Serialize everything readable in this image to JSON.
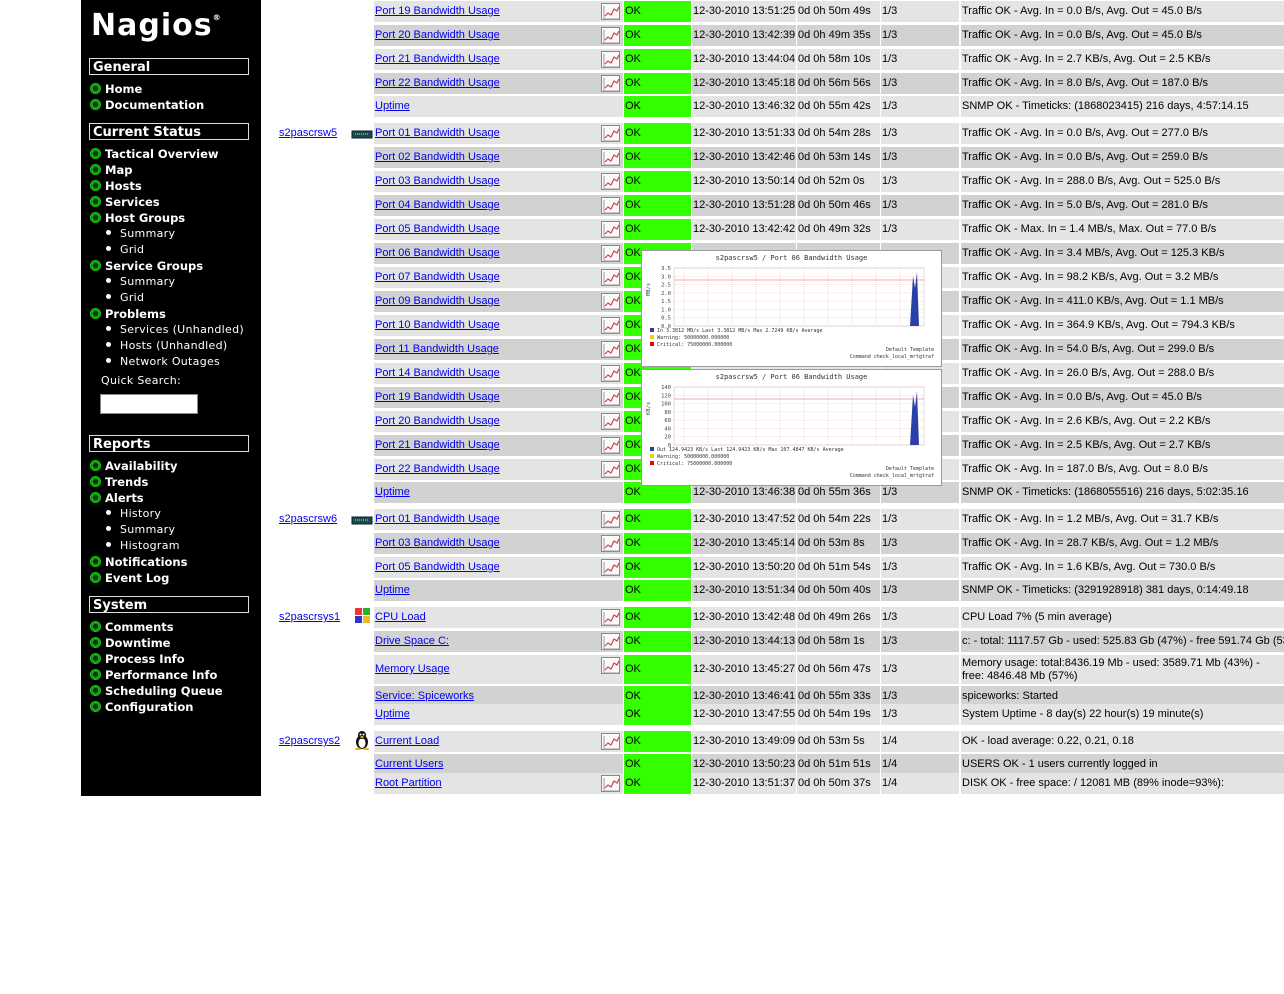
{
  "sidebar": {
    "logo": "Nagios",
    "logo_mark": "®",
    "sections": [
      {
        "title": "General",
        "items": [
          {
            "label": "Home",
            "sub": []
          },
          {
            "label": "Documentation",
            "sub": []
          }
        ]
      },
      {
        "title": "Current Status",
        "items": [
          {
            "label": "Tactical Overview",
            "sub": []
          },
          {
            "label": "Map",
            "sub": []
          },
          {
            "label": "Hosts",
            "sub": []
          },
          {
            "label": "Services",
            "sub": []
          },
          {
            "label": "Host Groups",
            "sub": [
              "Summary",
              "Grid"
            ]
          },
          {
            "label": "Service Groups",
            "sub": [
              "Summary",
              "Grid"
            ]
          },
          {
            "label": "Problems",
            "sub": [
              "Services (Unhandled)",
              "Hosts (Unhandled)",
              "Network Outages"
            ]
          }
        ]
      },
      {
        "title": "Reports",
        "items": [
          {
            "label": "Availability",
            "sub": []
          },
          {
            "label": "Trends",
            "sub": []
          },
          {
            "label": "Alerts",
            "sub": [
              "History",
              "Summary",
              "Histogram"
            ]
          },
          {
            "label": "Notifications",
            "sub": []
          },
          {
            "label": "Event Log",
            "sub": []
          }
        ]
      },
      {
        "title": "System",
        "items": [
          {
            "label": "Comments",
            "sub": []
          },
          {
            "label": "Downtime",
            "sub": []
          },
          {
            "label": "Process Info",
            "sub": []
          },
          {
            "label": "Performance Info",
            "sub": []
          },
          {
            "label": "Scheduling Queue",
            "sub": []
          },
          {
            "label": "Configuration",
            "sub": []
          }
        ]
      }
    ],
    "quick_search_label": "Quick Search:",
    "quick_search_value": ""
  },
  "colors": {
    "ok": "#33ff00",
    "row_light": "#e4e4e4",
    "row_dark": "#d2d2d2",
    "link": "#0000ee",
    "sidebar_bg": "#000000"
  },
  "groups": [
    {
      "host": "",
      "icon": "",
      "rows": [
        {
          "service": "Port 19 Bandwidth Usage",
          "graph": true,
          "status": "OK",
          "last_check": "12-30-2010 13:51:25",
          "duration": "0d 0h 50m 49s",
          "attempt": "1/3",
          "info": "Traffic OK - Avg. In = 0.0 B/s, Avg. Out = 45.0 B/s"
        },
        {
          "service": "Port 20 Bandwidth Usage",
          "graph": true,
          "status": "OK",
          "last_check": "12-30-2010 13:42:39",
          "duration": "0d 0h 49m 35s",
          "attempt": "1/3",
          "info": "Traffic OK - Avg. In = 0.0 B/s, Avg. Out = 45.0 B/s"
        },
        {
          "service": "Port 21 Bandwidth Usage",
          "graph": true,
          "status": "OK",
          "last_check": "12-30-2010 13:44:04",
          "duration": "0d 0h 58m 10s",
          "attempt": "1/3",
          "info": "Traffic OK - Avg. In = 2.7 KB/s, Avg. Out = 2.5 KB/s"
        },
        {
          "service": "Port 22 Bandwidth Usage",
          "graph": true,
          "status": "OK",
          "last_check": "12-30-2010 13:45:18",
          "duration": "0d 0h 56m 56s",
          "attempt": "1/3",
          "info": "Traffic OK - Avg. In = 8.0 B/s, Avg. Out = 187.0 B/s"
        },
        {
          "service": "Uptime",
          "graph": false,
          "status": "OK",
          "last_check": "12-30-2010 13:46:32",
          "duration": "0d 0h 55m 42s",
          "attempt": "1/3",
          "info": "SNMP OK - Timeticks: (1868023415) 216 days, 4:57:14.15"
        }
      ]
    },
    {
      "host": "s2pascrsw5",
      "icon": "switch-icon",
      "rows": [
        {
          "service": "Port 01 Bandwidth Usage",
          "graph": true,
          "status": "OK",
          "last_check": "12-30-2010 13:51:33",
          "duration": "0d 0h 54m 28s",
          "attempt": "1/3",
          "info": "Traffic OK - Avg. In = 0.0 B/s, Avg. Out = 277.0 B/s"
        },
        {
          "service": "Port 02 Bandwidth Usage",
          "graph": true,
          "status": "OK",
          "last_check": "12-30-2010 13:42:46",
          "duration": "0d 0h 53m 14s",
          "attempt": "1/3",
          "info": "Traffic OK - Avg. In = 0.0 B/s, Avg. Out = 259.0 B/s"
        },
        {
          "service": "Port 03 Bandwidth Usage",
          "graph": true,
          "status": "OK",
          "last_check": "12-30-2010 13:50:14",
          "duration": "0d 0h 52m 0s",
          "attempt": "1/3",
          "info": "Traffic OK - Avg. In = 288.0 B/s, Avg. Out = 525.0 B/s"
        },
        {
          "service": "Port 04 Bandwidth Usage",
          "graph": true,
          "status": "OK",
          "last_check": "12-30-2010 13:51:28",
          "duration": "0d 0h 50m 46s",
          "attempt": "1/3",
          "info": "Traffic OK - Avg. In = 5.0 B/s, Avg. Out = 281.0 B/s"
        },
        {
          "service": "Port 05 Bandwidth Usage",
          "graph": true,
          "status": "OK",
          "last_check": "12-30-2010 13:42:42",
          "duration": "0d 0h 49m 32s",
          "attempt": "1/3",
          "info": "Traffic OK - Max. In = 1.4 MB/s, Max. Out = 77.0 B/s"
        },
        {
          "service": "Port 06 Bandwidth Usage",
          "graph": true,
          "status": "OK",
          "last_check": "",
          "duration": "",
          "attempt": "",
          "info": "Traffic OK - Avg. In = 3.4 MB/s, Avg. Out = 125.3 KB/s"
        },
        {
          "service": "Port 07 Bandwidth Usage",
          "graph": true,
          "status": "OK",
          "last_check": "",
          "duration": "",
          "attempt": "",
          "info": "Traffic OK - Avg. In = 98.2 KB/s, Avg. Out = 3.2 MB/s"
        },
        {
          "service": "Port 09 Bandwidth Usage",
          "graph": true,
          "status": "OK",
          "last_check": "",
          "duration": "",
          "attempt": "",
          "info": "Traffic OK - Avg. In = 411.0 KB/s, Avg. Out = 1.1 MB/s"
        },
        {
          "service": "Port 10 Bandwidth Usage",
          "graph": true,
          "status": "OK",
          "last_check": "",
          "duration": "",
          "attempt": "",
          "info": "Traffic OK - Avg. In = 364.9 KB/s, Avg. Out = 794.3 KB/s"
        },
        {
          "service": "Port 11 Bandwidth Usage",
          "graph": true,
          "status": "OK",
          "last_check": "",
          "duration": "",
          "attempt": "",
          "info": "Traffic OK - Avg. In = 54.0 B/s, Avg. Out = 299.0 B/s"
        },
        {
          "service": "Port 14 Bandwidth Usage",
          "graph": true,
          "status": "OK",
          "last_check": "",
          "duration": "",
          "attempt": "",
          "info": "Traffic OK - Avg. In = 26.0 B/s, Avg. Out = 288.0 B/s"
        },
        {
          "service": "Port 19 Bandwidth Usage",
          "graph": true,
          "status": "OK",
          "last_check": "",
          "duration": "",
          "attempt": "",
          "info": "Traffic OK - Avg. In = 0.0 B/s, Avg. Out = 45.0 B/s"
        },
        {
          "service": "Port 20 Bandwidth Usage",
          "graph": true,
          "status": "OK",
          "last_check": "",
          "duration": "",
          "attempt": "",
          "info": "Traffic OK - Avg. In = 2.6 KB/s, Avg. Out = 2.2 KB/s"
        },
        {
          "service": "Port 21 Bandwidth Usage",
          "graph": true,
          "status": "OK",
          "last_check": "",
          "duration": "",
          "attempt": "",
          "info": "Traffic OK - Avg. In = 2.5 KB/s, Avg. Out = 2.7 KB/s"
        },
        {
          "service": "Port 22 Bandwidth Usage",
          "graph": true,
          "status": "OK",
          "last_check": "",
          "duration": "",
          "attempt": "",
          "info": "Traffic OK - Avg. In = 187.0 B/s, Avg. Out = 8.0 B/s"
        },
        {
          "service": "Uptime",
          "graph": false,
          "status": "OK",
          "last_check": "12-30-2010 13:46:38",
          "duration": "0d 0h 55m 36s",
          "attempt": "1/3",
          "info": "SNMP OK - Timeticks: (1868055516) 216 days, 5:02:35.16"
        }
      ]
    },
    {
      "host": "s2pascrsw6",
      "icon": "switch-icon",
      "rows": [
        {
          "service": "Port 01 Bandwidth Usage",
          "graph": true,
          "status": "OK",
          "last_check": "12-30-2010 13:47:52",
          "duration": "0d 0h 54m 22s",
          "attempt": "1/3",
          "info": "Traffic OK - Avg. In = 1.2 MB/s, Avg. Out = 31.7 KB/s"
        },
        {
          "service": "Port 03 Bandwidth Usage",
          "graph": true,
          "status": "OK",
          "last_check": "12-30-2010 13:45:14",
          "duration": "0d 0h 53m 8s",
          "attempt": "1/3",
          "info": "Traffic OK - Avg. In = 28.7 KB/s, Avg. Out = 1.2 MB/s"
        },
        {
          "service": "Port 05 Bandwidth Usage",
          "graph": true,
          "status": "OK",
          "last_check": "12-30-2010 13:50:20",
          "duration": "0d 0h 51m 54s",
          "attempt": "1/3",
          "info": "Traffic OK - Avg. In = 1.6 KB/s, Avg. Out = 730.0 B/s"
        },
        {
          "service": "Uptime",
          "graph": false,
          "status": "OK",
          "last_check": "12-30-2010 13:51:34",
          "duration": "0d 0h 50m 40s",
          "attempt": "1/3",
          "info": "SNMP OK - Timeticks: (3291928918) 381 days, 0:14:49.18"
        }
      ]
    },
    {
      "host": "s2pascrsys1",
      "icon": "windows-icon",
      "rows": [
        {
          "service": "CPU Load",
          "graph": true,
          "status": "OK",
          "last_check": "12-30-2010 13:42:48",
          "duration": "0d 0h 49m 26s",
          "attempt": "1/3",
          "info": "CPU Load 7% (5 min average)"
        },
        {
          "service": "Drive Space C:",
          "graph": true,
          "status": "OK",
          "last_check": "12-30-2010 13:44:13",
          "duration": "0d 0h 58m 1s",
          "attempt": "1/3",
          "info": "c: - total: 1117.57 Gb - used: 525.83 Gb (47%) - free 591.74 Gb (53%)"
        },
        {
          "service": "Memory Usage",
          "graph": true,
          "status": "OK",
          "last_check": "12-30-2010 13:45:27",
          "duration": "0d 0h 56m 47s",
          "attempt": "1/3",
          "info": "Memory usage: total:8436.19 Mb - used: 3589.71 Mb (43%) - free: 4846.48 Mb (57%)",
          "tall": true
        },
        {
          "service": "Service: Spiceworks",
          "graph": false,
          "status": "OK",
          "last_check": "12-30-2010 13:46:41",
          "duration": "0d 0h 55m 33s",
          "attempt": "1/3",
          "info": "spiceworks: Started"
        },
        {
          "service": "Uptime",
          "graph": false,
          "status": "OK",
          "last_check": "12-30-2010 13:47:55",
          "duration": "0d 0h 54m 19s",
          "attempt": "1/3",
          "info": "System Uptime - 8 day(s) 22 hour(s) 19 minute(s)"
        }
      ]
    },
    {
      "host": "s2pascrsys2",
      "icon": "linux-icon",
      "rows": [
        {
          "service": "Current Load",
          "graph": true,
          "status": "OK",
          "last_check": "12-30-2010 13:49:09",
          "duration": "0d 0h 53m 5s",
          "attempt": "1/4",
          "info": "OK - load average: 0.22, 0.21, 0.18"
        },
        {
          "service": "Current Users",
          "graph": false,
          "status": "OK",
          "last_check": "12-30-2010 13:50:23",
          "duration": "0d 0h 51m 51s",
          "attempt": "1/4",
          "info": "USERS OK - 1 users currently logged in"
        },
        {
          "service": "Root Partition",
          "graph": true,
          "status": "OK",
          "last_check": "12-30-2010 13:51:37",
          "duration": "0d 0h 50m 37s",
          "attempt": "1/4",
          "info": "DISK OK - free space: / 12081 MB (89% inode=93%):"
        }
      ]
    }
  ],
  "popups": [
    {
      "title": "s2pascrsw5 / Port 06 Bandwidth Usage",
      "y_ticks": [
        "3.5",
        "3.0",
        "2.5",
        "2.0",
        "1.5",
        "1.0",
        "0.5",
        "0.0"
      ],
      "y_unit": "MB/s",
      "legend": [
        "In      3.3812  MB/s Last  3.3812  MB/s Max  2.7249  KB/s Average",
        "Warning: 50000000.000000",
        "Critical: 75000000.000000"
      ],
      "footer": [
        "Default Template",
        "Command check_local_mrtgtraf"
      ]
    },
    {
      "title": "s2pascrsw5 / Port 06 Bandwidth Usage",
      "y_ticks": [
        "140",
        "120",
        "100",
        "80",
        "60",
        "40",
        "20",
        "0"
      ],
      "y_unit": "KB/s",
      "legend": [
        "Out     124.9423  KB/s Last  124.9423  KB/s Max  107.4847  KB/s Average",
        "Warning: 50000000.000000",
        "Critical: 75000000.000000"
      ],
      "footer": [
        "Default Template",
        "Command check_local_mrtgtraf"
      ]
    }
  ]
}
